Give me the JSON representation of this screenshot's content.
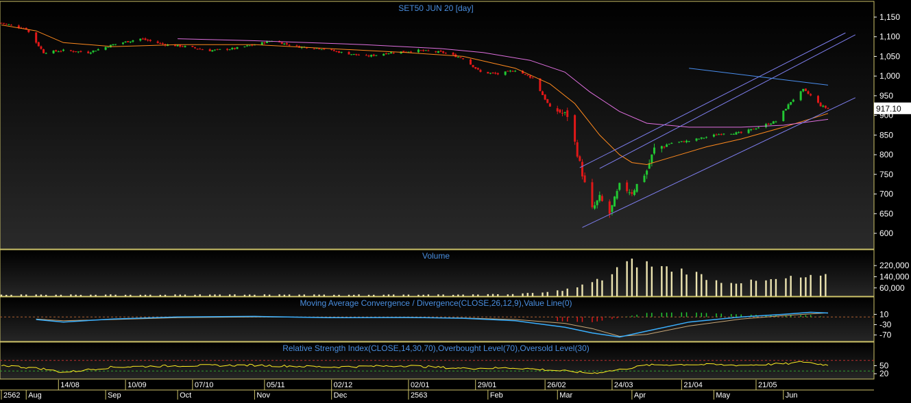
{
  "colors": {
    "background": "#000000",
    "panel_border": "#cfc56a",
    "title": "#4a8fe0",
    "axis_text": "#ffffff",
    "up_candle": "#22c833",
    "down_candle": "#e01818",
    "ma_short": "#ff8a1e",
    "ma_long": "#e070e0",
    "channel": "#7f7ff0",
    "resistance": "#4a8ff0",
    "volume_bar": "#ece4b0",
    "macd_line": "#3ab0ff",
    "signal_line": "#c8a878",
    "rsi_line": "#ffee22",
    "last_price_bg": "#ffffff"
  },
  "chart_data": [
    {
      "panel": "price",
      "type": "candlestick",
      "title": "SET50 JUN 20   [day]",
      "ylim": [
        560,
        1190
      ],
      "yticks": [
        600,
        650,
        700,
        750,
        800,
        850,
        900,
        950,
        1000,
        1050,
        1100,
        1150
      ],
      "ytick_labels": [
        "600",
        "650",
        "700",
        "750",
        "800",
        "850",
        "900",
        "950",
        "1,000",
        "1,050",
        "1,100",
        "1,150"
      ],
      "last_price_label": "917.10",
      "last_price": 917.1,
      "x_start": "2019-07-22",
      "x_end": "2020-06-19",
      "candles_anchor": [
        [
          "2019-07-22",
          1135
        ],
        [
          "2019-08-01",
          1120
        ],
        [
          "2019-08-08",
          1060
        ],
        [
          "2019-08-16",
          1065
        ],
        [
          "2019-08-26",
          1060
        ],
        [
          "2019-09-05",
          1080
        ],
        [
          "2019-09-16",
          1095
        ],
        [
          "2019-09-26",
          1080
        ],
        [
          "2019-10-04",
          1075
        ],
        [
          "2019-10-14",
          1065
        ],
        [
          "2019-10-24",
          1070
        ],
        [
          "2019-11-01",
          1080
        ],
        [
          "2019-11-08",
          1090
        ],
        [
          "2019-11-18",
          1075
        ],
        [
          "2019-11-28",
          1070
        ],
        [
          "2019-12-06",
          1060
        ],
        [
          "2019-12-16",
          1050
        ],
        [
          "2019-12-26",
          1060
        ],
        [
          "2020-01-06",
          1065
        ],
        [
          "2020-01-16",
          1060
        ],
        [
          "2020-01-24",
          1045
        ],
        [
          "2020-01-31",
          1010
        ],
        [
          "2020-02-07",
          1005
        ],
        [
          "2020-02-14",
          1015
        ],
        [
          "2020-02-21",
          995
        ],
        [
          "2020-02-28",
          920
        ],
        [
          "2020-03-06",
          900
        ],
        [
          "2020-03-09",
          830
        ],
        [
          "2020-03-13",
          725
        ],
        [
          "2020-03-16",
          660
        ],
        [
          "2020-03-19",
          690
        ],
        [
          "2020-03-23",
          650
        ],
        [
          "2020-03-27",
          720
        ],
        [
          "2020-04-01",
          705
        ],
        [
          "2020-04-07",
          760
        ],
        [
          "2020-04-10",
          815
        ],
        [
          "2020-04-17",
          830
        ],
        [
          "2020-04-24",
          835
        ],
        [
          "2020-05-01",
          845
        ],
        [
          "2020-05-08",
          855
        ],
        [
          "2020-05-15",
          855
        ],
        [
          "2020-05-22",
          870
        ],
        [
          "2020-05-29",
          885
        ],
        [
          "2020-06-04",
          935
        ],
        [
          "2020-06-09",
          965
        ],
        [
          "2020-06-12",
          950
        ],
        [
          "2020-06-16",
          925
        ],
        [
          "2020-06-19",
          917
        ]
      ],
      "ma_short": [
        [
          "2019-07-22",
          1130
        ],
        [
          "2019-08-05",
          1115
        ],
        [
          "2019-08-16",
          1085
        ],
        [
          "2019-09-05",
          1075
        ],
        [
          "2019-10-01",
          1080
        ],
        [
          "2019-11-01",
          1080
        ],
        [
          "2019-12-01",
          1070
        ],
        [
          "2020-01-01",
          1060
        ],
        [
          "2020-01-24",
          1050
        ],
        [
          "2020-02-14",
          1020
        ],
        [
          "2020-02-28",
          980
        ],
        [
          "2020-03-09",
          930
        ],
        [
          "2020-03-19",
          850
        ],
        [
          "2020-03-27",
          800
        ],
        [
          "2020-04-01",
          780
        ],
        [
          "2020-04-07",
          775
        ],
        [
          "2020-04-15",
          790
        ],
        [
          "2020-05-01",
          820
        ],
        [
          "2020-05-15",
          840
        ],
        [
          "2020-06-01",
          870
        ],
        [
          "2020-06-19",
          905
        ]
      ],
      "ma_long": [
        [
          "2019-10-01",
          1095
        ],
        [
          "2019-11-01",
          1090
        ],
        [
          "2019-12-15",
          1080
        ],
        [
          "2020-01-15",
          1070
        ],
        [
          "2020-02-01",
          1060
        ],
        [
          "2020-02-20",
          1040
        ],
        [
          "2020-03-05",
          1010
        ],
        [
          "2020-03-15",
          960
        ],
        [
          "2020-03-27",
          910
        ],
        [
          "2020-04-07",
          880
        ],
        [
          "2020-04-24",
          870
        ],
        [
          "2020-05-15",
          870
        ],
        [
          "2020-06-01",
          875
        ],
        [
          "2020-06-19",
          890
        ]
      ],
      "channel_lines": [
        [
          [
            "2020-03-11",
            767
          ],
          [
            "2020-06-26",
            1110
          ]
        ],
        [
          [
            "2020-03-19",
            765
          ],
          [
            "2020-06-30",
            1105
          ]
        ],
        [
          [
            "2020-03-12",
            615
          ],
          [
            "2020-06-30",
            945
          ]
        ]
      ],
      "resistance_line": [
        [
          "2020-04-24",
          1020
        ],
        [
          "2020-06-19",
          977
        ]
      ]
    },
    {
      "panel": "volume",
      "type": "bar",
      "title": "Volume",
      "ylim": [
        0,
        260000
      ],
      "yticks": [
        60000,
        140000,
        220000
      ],
      "ytick_labels": [
        "60,000",
        "140,000",
        "220,000"
      ],
      "bars": [
        [
          "2019-07-22",
          12000
        ],
        [
          "2020-01-20",
          12000
        ],
        [
          "2020-02-14",
          16000
        ],
        [
          "2020-02-28",
          30000
        ],
        [
          "2020-03-09",
          60000
        ],
        [
          "2020-03-16",
          100000
        ],
        [
          "2020-03-23",
          140000
        ],
        [
          "2020-03-27",
          220000
        ],
        [
          "2020-04-01",
          240000
        ],
        [
          "2020-04-07",
          230000
        ],
        [
          "2020-04-15",
          200000
        ],
        [
          "2020-04-24",
          180000
        ],
        [
          "2020-05-05",
          110000
        ],
        [
          "2020-05-15",
          100000
        ],
        [
          "2020-05-25",
          110000
        ],
        [
          "2020-06-04",
          130000
        ],
        [
          "2020-06-19",
          140000
        ]
      ]
    },
    {
      "panel": "macd",
      "type": "line",
      "title": "Moving Average Convergence / Divergence(CLOSE,26,12,9),Value Line(0)",
      "ylim": [
        -95,
        35
      ],
      "yticks": [
        -70,
        -30,
        10
      ],
      "ytick_labels": [
        "-70",
        "-30",
        "10"
      ],
      "macd": [
        [
          "2019-08-05",
          -10
        ],
        [
          "2019-08-16",
          -20
        ],
        [
          "2019-09-05",
          -8
        ],
        [
          "2019-10-01",
          0
        ],
        [
          "2019-11-01",
          2
        ],
        [
          "2019-12-01",
          -3
        ],
        [
          "2020-01-01",
          -2
        ],
        [
          "2020-01-24",
          -5
        ],
        [
          "2020-02-14",
          -15
        ],
        [
          "2020-03-05",
          -40
        ],
        [
          "2020-03-16",
          -62
        ],
        [
          "2020-03-27",
          -78
        ],
        [
          "2020-04-07",
          -55
        ],
        [
          "2020-04-24",
          -20
        ],
        [
          "2020-05-15",
          0
        ],
        [
          "2020-06-01",
          10
        ],
        [
          "2020-06-12",
          18
        ],
        [
          "2020-06-19",
          15
        ]
      ],
      "signal": [
        [
          "2019-08-05",
          -8
        ],
        [
          "2019-08-16",
          -15
        ],
        [
          "2019-09-05",
          -10
        ],
        [
          "2019-10-01",
          -3
        ],
        [
          "2019-11-01",
          0
        ],
        [
          "2019-12-01",
          -2
        ],
        [
          "2020-01-01",
          -3
        ],
        [
          "2020-01-24",
          -4
        ],
        [
          "2020-02-14",
          -10
        ],
        [
          "2020-03-05",
          -25
        ],
        [
          "2020-03-16",
          -45
        ],
        [
          "2020-03-27",
          -75
        ],
        [
          "2020-04-07",
          -68
        ],
        [
          "2020-04-24",
          -35
        ],
        [
          "2020-05-15",
          -8
        ],
        [
          "2020-06-01",
          5
        ],
        [
          "2020-06-12",
          12
        ],
        [
          "2020-06-19",
          16
        ]
      ]
    },
    {
      "panel": "rsi",
      "type": "line",
      "title": "Relative Strength Index(CLOSE,14,30,70),Overbought Level(70),Oversold Level(30)",
      "ylim": [
        0,
        100
      ],
      "yticks": [
        20,
        50
      ],
      "ytick_labels": [
        "20",
        "50"
      ],
      "overbought": 70,
      "oversold": 30,
      "rsi": [
        [
          "2019-07-22",
          52
        ],
        [
          "2019-08-08",
          38
        ],
        [
          "2019-08-16",
          25
        ],
        [
          "2019-09-05",
          45
        ],
        [
          "2019-10-01",
          50
        ],
        [
          "2019-11-01",
          52
        ],
        [
          "2019-12-01",
          45
        ],
        [
          "2020-01-01",
          50
        ],
        [
          "2020-01-24",
          40
        ],
        [
          "2020-02-14",
          42
        ],
        [
          "2020-03-05",
          30
        ],
        [
          "2020-03-16",
          22
        ],
        [
          "2020-03-27",
          35
        ],
        [
          "2020-04-07",
          52
        ],
        [
          "2020-04-24",
          55
        ],
        [
          "2020-05-15",
          52
        ],
        [
          "2020-06-04",
          58
        ],
        [
          "2020-06-09",
          65
        ],
        [
          "2020-06-19",
          52
        ]
      ]
    }
  ],
  "x_axis": {
    "day_labels": [
      {
        "date": "2019-08-14",
        "text": "14/08"
      },
      {
        "date": "2019-09-10",
        "text": "10/09"
      },
      {
        "date": "2019-10-07",
        "text": "07/10"
      },
      {
        "date": "2019-11-05",
        "text": "05/11"
      },
      {
        "date": "2019-12-02",
        "text": "02/12"
      },
      {
        "date": "2020-01-02",
        "text": "02/01"
      },
      {
        "date": "2020-01-29",
        "text": "29/01"
      },
      {
        "date": "2020-02-26",
        "text": "26/02"
      },
      {
        "date": "2020-03-24",
        "text": "24/03"
      },
      {
        "date": "2020-04-21",
        "text": "21/04"
      },
      {
        "date": "2020-05-21",
        "text": "21/05"
      }
    ],
    "month_labels": [
      {
        "date": "2019-07-22",
        "text": "2562"
      },
      {
        "date": "2019-08-01",
        "text": "Aug"
      },
      {
        "date": "2019-09-02",
        "text": "Sep"
      },
      {
        "date": "2019-10-01",
        "text": "Oct"
      },
      {
        "date": "2019-11-01",
        "text": "Nov"
      },
      {
        "date": "2019-12-02",
        "text": "Dec"
      },
      {
        "date": "2020-01-02",
        "text": "2563"
      },
      {
        "date": "2020-02-03",
        "text": "Feb"
      },
      {
        "date": "2020-03-02",
        "text": "Mar"
      },
      {
        "date": "2020-04-01",
        "text": "Apr"
      },
      {
        "date": "2020-05-04",
        "text": "May"
      },
      {
        "date": "2020-06-01",
        "text": "Jun"
      }
    ]
  }
}
